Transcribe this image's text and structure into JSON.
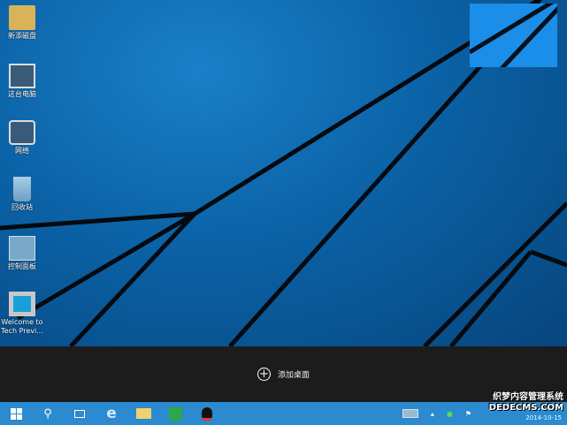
{
  "desktop": {
    "icons": [
      {
        "label": "新添磁盘",
        "icon": "user-folder-icon"
      },
      {
        "label": "这台电脑",
        "icon": "computer-icon"
      },
      {
        "label": "网络",
        "icon": "network-icon"
      },
      {
        "label": "回收站",
        "icon": "recycle-bin-icon"
      },
      {
        "label": "控制面板",
        "icon": "control-panel-icon"
      },
      {
        "label": "Welcome to Tech Previ...",
        "icon": "windows-shortcut-icon"
      }
    ]
  },
  "task_view": {
    "add_desktop_label": "添加桌面"
  },
  "taskbar": {
    "items": [
      "start",
      "search",
      "task-view",
      "internet-explorer",
      "file-explorer",
      "store",
      "qq"
    ]
  },
  "tray": {
    "date": "2014-10-15"
  },
  "watermark": {
    "line1": "织梦内容管理系统",
    "line2": "DEDECMS.COM"
  },
  "colors": {
    "taskbar": "#2b8ad0",
    "taskview_bar": "#1c1c1c",
    "desktop": "#0b62a6"
  }
}
